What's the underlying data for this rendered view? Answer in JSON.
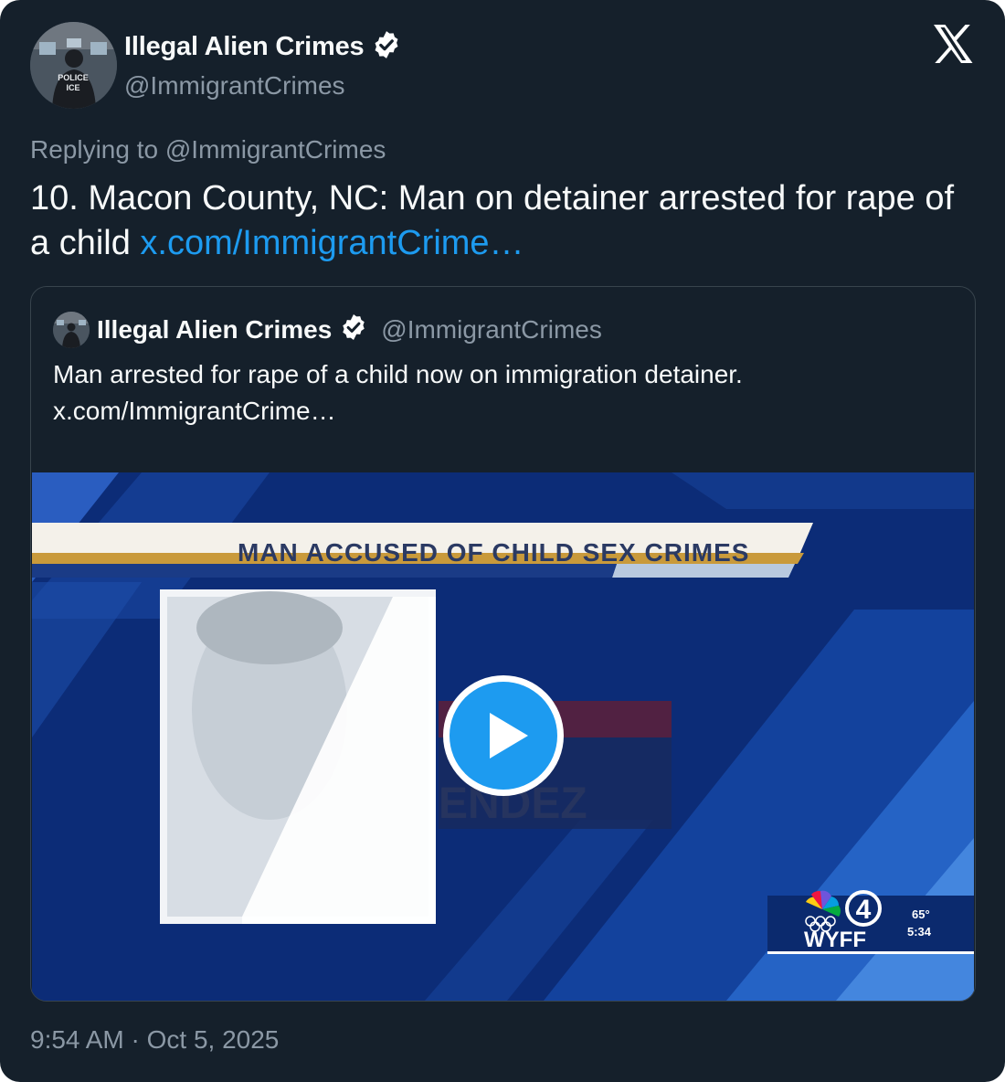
{
  "author": {
    "display_name": "Illegal Alien Crimes",
    "handle": "@ImmigrantCrimes",
    "avatar_badge_text": [
      "POLICE",
      "ICE"
    ]
  },
  "icons": {
    "verified": "verified-badge-icon",
    "platform": "x-logo-icon",
    "play": "play-icon"
  },
  "reply_context": "Replying to @ImmigrantCrimes",
  "tweet": {
    "text": "10. Macon County, NC: Man on detainer arrested for rape of a child ",
    "link": "x.com/ImmigrantCrime…"
  },
  "quoted_tweet": {
    "display_name": "Illegal Alien Crimes",
    "handle": "@ImmigrantCrimes",
    "text": "Man arrested for rape of a child now on immigration detainer.",
    "link": "x.com/ImmigrantCrime…",
    "video": {
      "headline": "MAN ACCUSED OF CHILD SEX CRIMES",
      "background_text": "ENDEZ",
      "station": {
        "channel": "4",
        "call_letters": "WYFF",
        "temperature": "65°",
        "time": "5:34"
      }
    }
  },
  "timestamp": "9:54 AM · Oct 5, 2025",
  "colors": {
    "background": "#15202b",
    "text": "#f7f9f9",
    "secondary_text": "#8b98a5",
    "link": "#1d9bf0",
    "border": "#38444d",
    "verified": "#ffffff",
    "video_blue": "#0d2f7a"
  }
}
